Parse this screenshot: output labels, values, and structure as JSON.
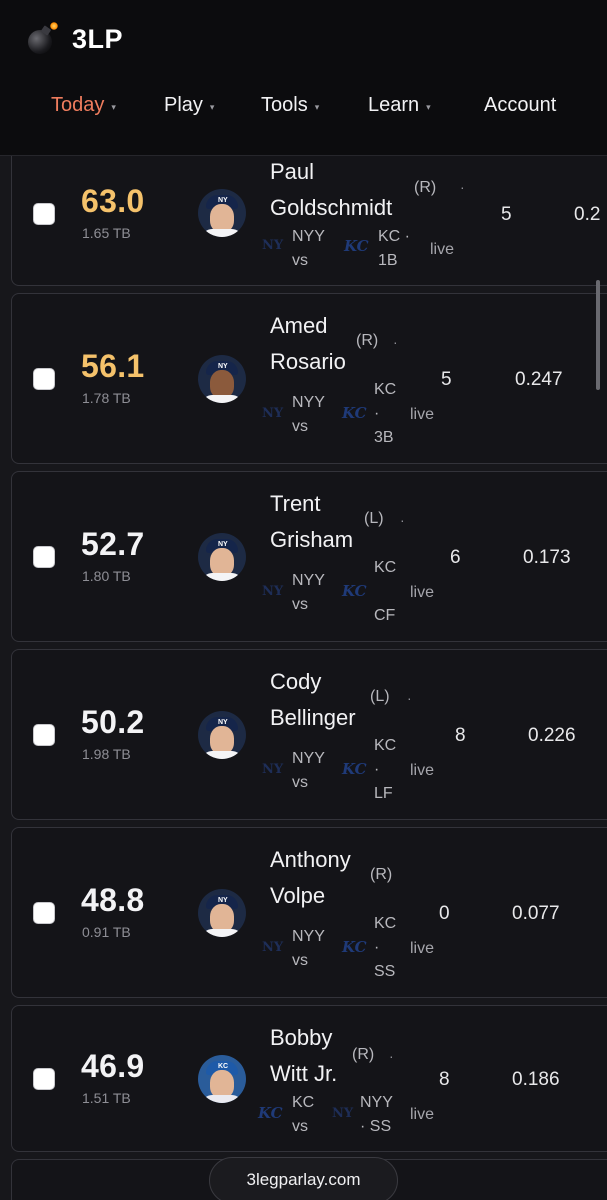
{
  "brand": {
    "name": "3LP"
  },
  "nav": [
    {
      "label": "Today",
      "active": true,
      "caret": "▾"
    },
    {
      "label": "Play",
      "caret": "▾"
    },
    {
      "label": "Tools",
      "caret": "▾"
    },
    {
      "label": "Learn",
      "caret": "▾"
    },
    {
      "label": "Account",
      "caret": ""
    }
  ],
  "players": [
    {
      "score": "63.0",
      "tb": "1.65 TB",
      "name1": "Paul",
      "name2": "Goldschmidt",
      "hand": "(R)",
      "dot": "·",
      "teamA": "NYY",
      "vs": "vs",
      "teamB": "KC ·",
      "pos": "1B",
      "status": "live",
      "stat1": "5",
      "stat2": "0.2",
      "gold": true
    },
    {
      "score": "56.1",
      "tb": "1.78 TB",
      "name1": "Amed",
      "name2": "Rosario",
      "hand": "(R)",
      "dot": "·",
      "teamA": "NYY",
      "vs": "vs",
      "teamB": "KC",
      "sep": "·",
      "pos": "3B",
      "status": "live",
      "stat1": "5",
      "stat2": "0.247",
      "gold": true
    },
    {
      "score": "52.7",
      "tb": "1.80 TB",
      "name1": "Trent",
      "name2": "Grisham",
      "hand": "(L)",
      "dot": "·",
      "teamA": "NYY",
      "vs": "vs",
      "teamB": "KC",
      "sep": "",
      "pos": "CF",
      "status": "live",
      "stat1": "6",
      "stat2": "0.173",
      "gold": false
    },
    {
      "score": "50.2",
      "tb": "1.98 TB",
      "name1": "Cody",
      "name2": "Bellinger",
      "hand": "(L)",
      "dot": "·",
      "teamA": "NYY",
      "vs": "vs",
      "teamB": "KC",
      "sep": "·",
      "pos": "LF",
      "status": "live",
      "stat1": "8",
      "stat2": "0.226",
      "gold": false
    },
    {
      "score": "48.8",
      "tb": "0.91 TB",
      "name1": "Anthony",
      "name2": "Volpe",
      "hand": "(R)",
      "dot": "",
      "teamA": "NYY",
      "vs": "vs",
      "teamB": "KC",
      "sep": "·",
      "pos": "SS",
      "status": "live",
      "stat1": "0",
      "stat2": "0.077",
      "gold": false
    },
    {
      "score": "46.9",
      "tb": "1.51 TB",
      "name1": "Bobby",
      "name2": "Witt Jr.",
      "hand": "(R)",
      "dot": "·",
      "teamA": "KC",
      "vs": "vs",
      "teamB": "NYY",
      "sep": "· SS",
      "pos": "",
      "status": "live",
      "stat1": "8",
      "stat2": "0.186",
      "gold": false
    }
  ],
  "logos": {
    "nyy": "NY",
    "kc": "KC"
  },
  "footer": {
    "site": "3legparlay.com"
  },
  "colors": {
    "accent_active": "#ef7d5e",
    "gold_score": "#f5c26b",
    "background": "#17171b"
  }
}
